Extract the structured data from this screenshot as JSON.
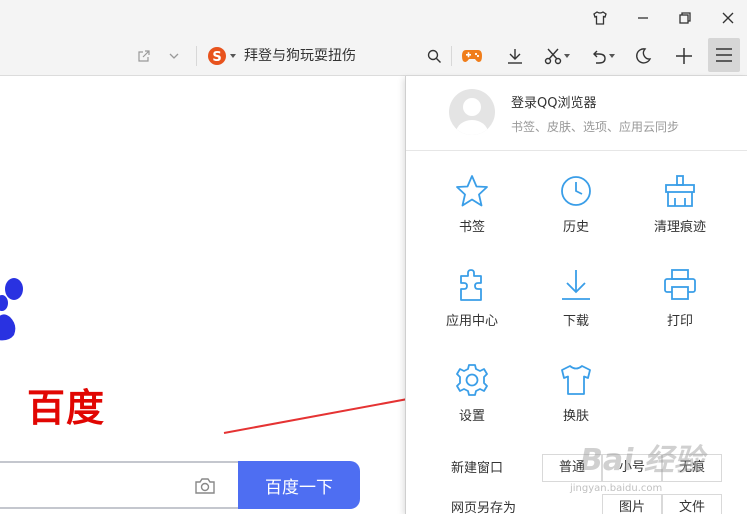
{
  "toolbar": {
    "search_engine_icon": "sogou-s-icon",
    "search_suggestion": "拜登与狗玩耍扭伤"
  },
  "page": {
    "logo_text": "百度",
    "search_button_label": "百度一下"
  },
  "menu": {
    "login_title": "登录QQ浏览器",
    "login_subtitle": "书签、皮肤、选项、应用云同步",
    "items": [
      {
        "label": "书签",
        "icon": "star-icon"
      },
      {
        "label": "历史",
        "icon": "clock-icon"
      },
      {
        "label": "清理痕迹",
        "icon": "broom-icon"
      },
      {
        "label": "应用中心",
        "icon": "puzzle-icon"
      },
      {
        "label": "下载",
        "icon": "download-icon"
      },
      {
        "label": "打印",
        "icon": "printer-icon"
      },
      {
        "label": "设置",
        "icon": "gear-icon"
      },
      {
        "label": "换肤",
        "icon": "shirt-icon"
      }
    ],
    "new_window": {
      "label": "新建窗口",
      "options": [
        "普通",
        "小号",
        "无痕"
      ]
    },
    "save_page": {
      "label": "网页另存为",
      "options": [
        "图片",
        "文件"
      ]
    }
  },
  "watermark": {
    "text": "Bai 经验",
    "sub": "jingyan.baidu.com"
  },
  "colors": {
    "accent_blue": "#3a9ee8",
    "baidu_red": "#e10602",
    "baidu_blue": "#2932e1",
    "search_button": "#4e6ef2",
    "arrow_red": "#e53333"
  }
}
